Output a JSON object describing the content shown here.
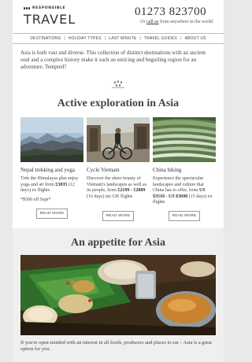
{
  "header": {
    "logo_top": "RESPONSIBLE",
    "logo_main": "TRAVEL",
    "phone": "01273 823700",
    "call_prefix": "Or ",
    "call_link": "call us",
    "call_suffix": " from anywhere in the world"
  },
  "nav": {
    "items": [
      "DESTINATIONS",
      "HOLIDAY TYPES",
      "LAST MINUTE",
      "TRAVEL GUIDES",
      "ABOUT US"
    ],
    "separator": "|"
  },
  "intro": "Asia is both vast and diverse. This collection of distinct destinations with an ancient soul and a complex history make it such an enticing and beguiling region for an adventure. Tempted?",
  "section1": {
    "title": "Active exploration in Asia",
    "cards": [
      {
        "title": "Nepal trekking and yoga",
        "body_pre": "Trek the Himalayas plus enjoy yoga and art from ",
        "price": "£3035",
        "body_post": " (12 days) ex flights",
        "note": "*$500 off Sept*",
        "button": "READ MORE"
      },
      {
        "title": "Cycle Vietnam",
        "body_pre": "Discover the sheer beauty of Vietnam's landscapes as well as its people, from ",
        "price": "£2199 - £2889",
        "body_post": " (16 days) inc UK flights",
        "note": "",
        "button": "READ MORE"
      },
      {
        "title": "China hiking",
        "body_pre": "Experience the spectacular landscapes and culture that China has to offer, from ",
        "price": "US $3518 - US $3698",
        "body_post": " (15 days) ex flights",
        "note": "",
        "button": "READ MORE"
      }
    ]
  },
  "section2": {
    "title": "An appetite for Asia",
    "outro": "If you're open-minded with an interest in all foods, producers and places to eat – Asia is a great option for you."
  }
}
